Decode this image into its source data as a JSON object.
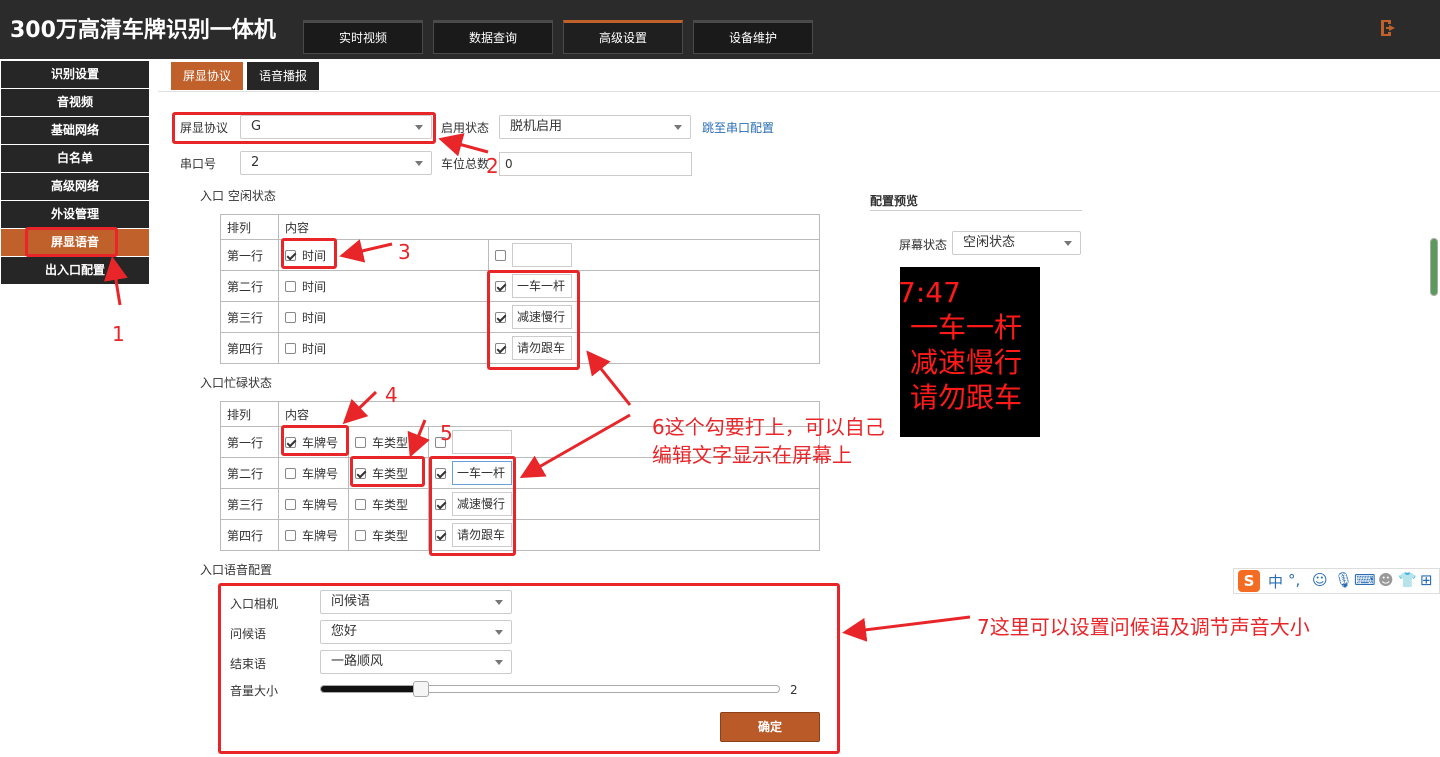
{
  "header": {
    "title": "300万高清车牌识别一体机",
    "tabs": [
      "实时视频",
      "数据查询",
      "高级设置",
      "设备维护"
    ]
  },
  "sidebar": {
    "items": [
      "识别设置",
      "音视频",
      "基础网络",
      "白名单",
      "高级网络",
      "外设管理",
      "屏显语音",
      "出入口配置"
    ]
  },
  "subtabs": [
    "屏显协议",
    "语音播报"
  ],
  "form": {
    "protocol_label": "屏显协议",
    "protocol_value": "G",
    "enable_label": "启用状态",
    "enable_value": "脱机启用",
    "jump_link": "跳至串口配置",
    "serial_label": "串口号",
    "serial_value": "2",
    "spaces_label": "车位总数",
    "spaces_value": "0"
  },
  "idle_section": {
    "title": "入口 空闲状态",
    "col_order": "排列",
    "col_content": "内容",
    "rows": [
      "第一行",
      "第二行",
      "第三行",
      "第四行"
    ],
    "time_label": "时间",
    "custom_texts": [
      "",
      "一车一杆",
      "减速慢行",
      "请勿跟车"
    ]
  },
  "busy_section": {
    "title": "入口忙碌状态",
    "col_order": "排列",
    "col_content": "内容",
    "rows": [
      "第一行",
      "第二行",
      "第三行",
      "第四行"
    ],
    "plate_label": "车牌号",
    "type_label": "车类型",
    "custom_texts": [
      "",
      "一车一杆",
      "减速慢行",
      "请勿跟车"
    ]
  },
  "voice_section": {
    "title": "入口语音配置",
    "camera_label": "入口相机",
    "camera_value": "问候语",
    "greeting_label": "问候语",
    "greeting_value": "您好",
    "ending_label": "结束语",
    "ending_value": "一路顺风",
    "volume_label": "音量大小",
    "volume_value": "2",
    "volume_fraction": 0.22,
    "confirm_label": "确定"
  },
  "preview": {
    "title": "配置预览",
    "screen_state_label": "屏幕状态",
    "screen_state_value": "空闲状态",
    "led_lines": [
      "7:47",
      "一车一杆",
      "减速慢行",
      "请勿跟车"
    ]
  },
  "annotations": {
    "n1": "1",
    "n2": "2",
    "n3": "3",
    "n4": "4",
    "n5": "5",
    "note6_line1": "6这个勾要打上，可以自己",
    "note6_line2": "编辑文字显示在屏幕上",
    "note7": "7这里可以设置问候语及调节声音大小"
  },
  "ime": {
    "logo": "S",
    "mode": "中",
    "punct": "°,"
  },
  "colors": {
    "accent": "#c0612b",
    "annotation": "#e8262a",
    "header_bg": "#2b2b2b",
    "led_text": "#ff1a1a"
  }
}
